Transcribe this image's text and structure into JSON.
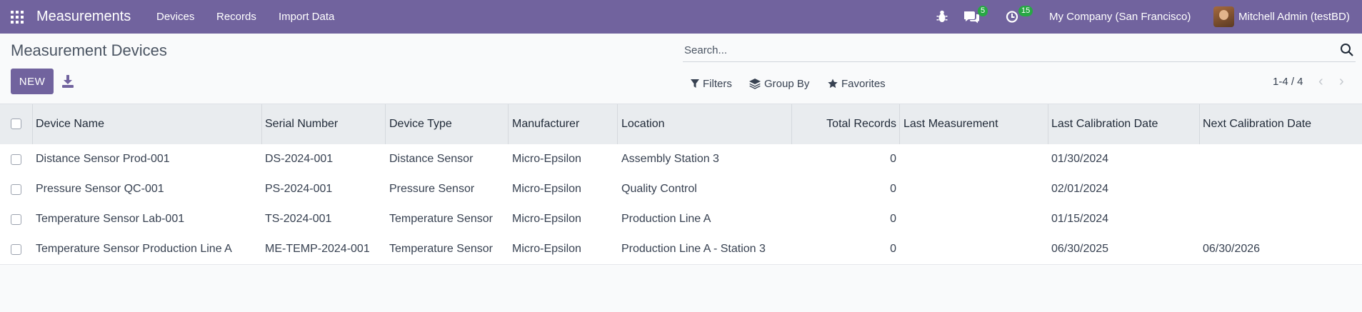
{
  "topbar": {
    "app_name": "Measurements",
    "menu": [
      "Devices",
      "Records",
      "Import Data"
    ],
    "messages_count": "5",
    "activities_count": "15",
    "company": "My Company (San Francisco)",
    "user": "Mitchell Admin (testBD)",
    "bg_color": "#71639e"
  },
  "page": {
    "title": "Measurement Devices",
    "new_label": "NEW",
    "search_placeholder": "Search...",
    "filters_label": "Filters",
    "group_by_label": "Group By",
    "favorites_label": "Favorites",
    "pager": "1-4 / 4"
  },
  "table": {
    "columns": [
      "Device Name",
      "Serial Number",
      "Device Type",
      "Manufacturer",
      "Location",
      "Total Records",
      "Last Measurement",
      "Last Calibration Date",
      "Next Calibration Date"
    ],
    "rows": [
      [
        "Distance Sensor Prod-001",
        "DS-2024-001",
        "Distance Sensor",
        "Micro-Epsilon",
        "Assembly Station 3",
        "0",
        "",
        "01/30/2024",
        ""
      ],
      [
        "Pressure Sensor QC-001",
        "PS-2024-001",
        "Pressure Sensor",
        "Micro-Epsilon",
        "Quality Control",
        "0",
        "",
        "02/01/2024",
        ""
      ],
      [
        "Temperature Sensor Lab-001",
        "TS-2024-001",
        "Temperature Sensor",
        "Micro-Epsilon",
        "Production Line A",
        "0",
        "",
        "01/15/2024",
        ""
      ],
      [
        "Temperature Sensor Production Line A",
        "ME-TEMP-2024-001",
        "Temperature Sensor",
        "Micro-Epsilon",
        "Production Line A - Station 3",
        "0",
        "",
        "06/30/2025",
        "06/30/2026"
      ]
    ]
  }
}
